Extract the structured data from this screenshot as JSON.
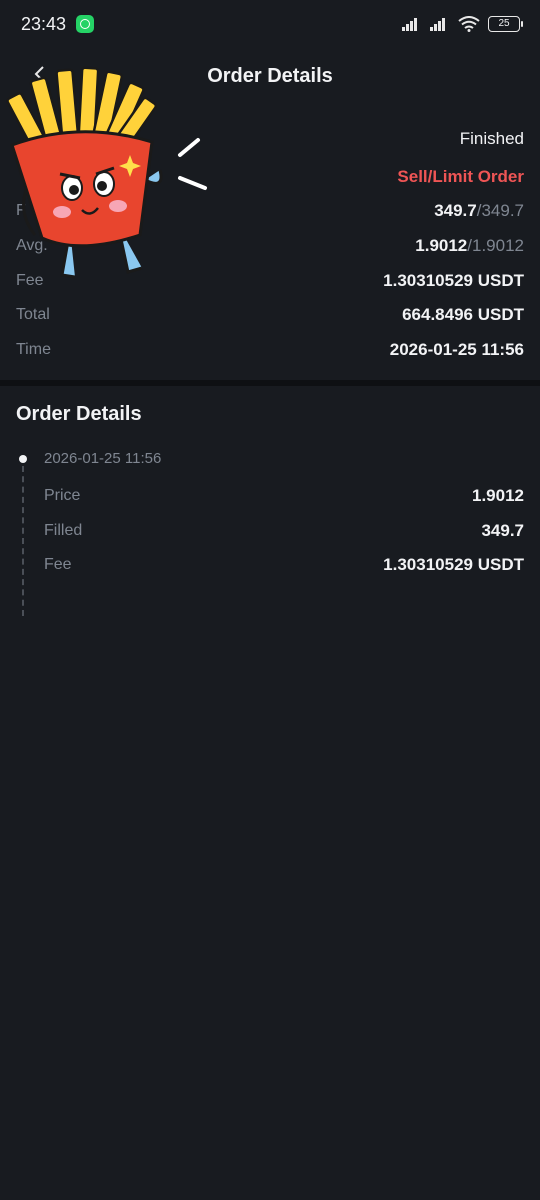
{
  "status": {
    "time": "23:43",
    "battery": "25"
  },
  "nav": {
    "title": "Order Details"
  },
  "summary": {
    "status_value": "Finished",
    "side_value": "Sell/Limit Order",
    "filled": {
      "label": "F",
      "value": "349.7",
      "total": "/349.7"
    },
    "avg": {
      "label": "Avg.",
      "value": "1.9012",
      "total": "/1.9012"
    },
    "fee": {
      "label": "Fee",
      "value": "1.30310529 USDT"
    },
    "total": {
      "label": "Total",
      "value": "664.8496 USDT"
    },
    "time": {
      "label": "Time",
      "value": "2026-01-25 11:56"
    }
  },
  "details": {
    "title": "Order Details",
    "timestamp": "2026-01-25 11:56",
    "rows": [
      {
        "label": "Price",
        "value": "1.9012"
      },
      {
        "label": "Filled",
        "value": "349.7"
      },
      {
        "label": "Fee",
        "value": "1.30310529 USDT"
      }
    ]
  },
  "colors": {
    "background": "#181b20",
    "sell": "#ef5555",
    "muted": "#7f8691"
  },
  "icons": [
    "whatsapp-icon",
    "signal-icon",
    "wifi-icon",
    "battery-icon",
    "back-arrow-icon",
    "fries-sticker"
  ]
}
